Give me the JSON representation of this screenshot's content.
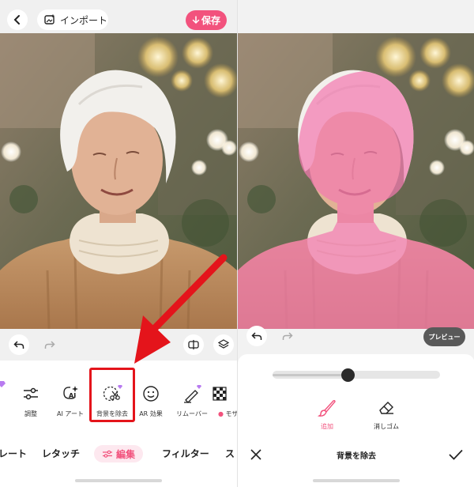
{
  "left": {
    "topbar": {
      "import_label": "インポート",
      "save_label": "保存"
    },
    "tools": [
      {
        "label": "調整",
        "icon": "sliders-icon"
      },
      {
        "label": "AI アート",
        "icon": "ai-art-icon"
      },
      {
        "label": "背景を除去",
        "icon": "remove-background-icon"
      },
      {
        "label": "AR 効果",
        "icon": "smiley-icon"
      },
      {
        "label": "リムーバー",
        "icon": "eraser-pen-icon"
      },
      {
        "label": "モザ",
        "icon": "mosaic-icon"
      }
    ],
    "tabs": [
      {
        "label": "レート"
      },
      {
        "label": "レタッチ"
      },
      {
        "label": "編集",
        "active": true
      },
      {
        "label": "フィルター"
      },
      {
        "label": "ス"
      }
    ]
  },
  "right": {
    "preview_label": "プレビュー",
    "brush_size": 0.45,
    "modes": [
      {
        "label": "追加",
        "icon": "brush-icon",
        "active": true
      },
      {
        "label": "消しゴム",
        "icon": "eraser-icon",
        "active": false
      }
    ],
    "title": "背景を除去"
  },
  "colors": {
    "accent": "#f2527d",
    "highlight": "#e4141b",
    "mask": "#f27ab0"
  }
}
